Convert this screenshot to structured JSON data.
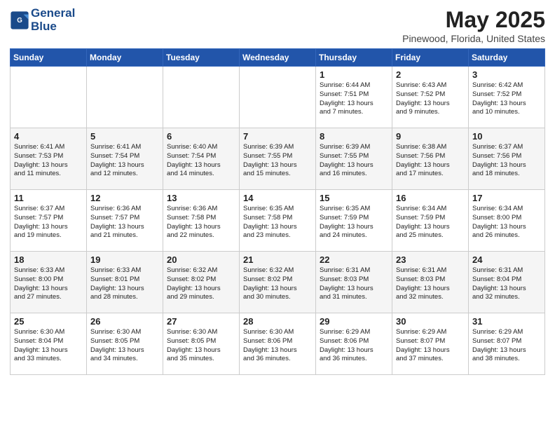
{
  "header": {
    "logo_line1": "General",
    "logo_line2": "Blue",
    "month": "May 2025",
    "location": "Pinewood, Florida, United States"
  },
  "weekdays": [
    "Sunday",
    "Monday",
    "Tuesday",
    "Wednesday",
    "Thursday",
    "Friday",
    "Saturday"
  ],
  "weeks": [
    [
      {
        "day": "",
        "info": ""
      },
      {
        "day": "",
        "info": ""
      },
      {
        "day": "",
        "info": ""
      },
      {
        "day": "",
        "info": ""
      },
      {
        "day": "1",
        "info": "Sunrise: 6:44 AM\nSunset: 7:51 PM\nDaylight: 13 hours\nand 7 minutes."
      },
      {
        "day": "2",
        "info": "Sunrise: 6:43 AM\nSunset: 7:52 PM\nDaylight: 13 hours\nand 9 minutes."
      },
      {
        "day": "3",
        "info": "Sunrise: 6:42 AM\nSunset: 7:52 PM\nDaylight: 13 hours\nand 10 minutes."
      }
    ],
    [
      {
        "day": "4",
        "info": "Sunrise: 6:41 AM\nSunset: 7:53 PM\nDaylight: 13 hours\nand 11 minutes."
      },
      {
        "day": "5",
        "info": "Sunrise: 6:41 AM\nSunset: 7:54 PM\nDaylight: 13 hours\nand 12 minutes."
      },
      {
        "day": "6",
        "info": "Sunrise: 6:40 AM\nSunset: 7:54 PM\nDaylight: 13 hours\nand 14 minutes."
      },
      {
        "day": "7",
        "info": "Sunrise: 6:39 AM\nSunset: 7:55 PM\nDaylight: 13 hours\nand 15 minutes."
      },
      {
        "day": "8",
        "info": "Sunrise: 6:39 AM\nSunset: 7:55 PM\nDaylight: 13 hours\nand 16 minutes."
      },
      {
        "day": "9",
        "info": "Sunrise: 6:38 AM\nSunset: 7:56 PM\nDaylight: 13 hours\nand 17 minutes."
      },
      {
        "day": "10",
        "info": "Sunrise: 6:37 AM\nSunset: 7:56 PM\nDaylight: 13 hours\nand 18 minutes."
      }
    ],
    [
      {
        "day": "11",
        "info": "Sunrise: 6:37 AM\nSunset: 7:57 PM\nDaylight: 13 hours\nand 19 minutes."
      },
      {
        "day": "12",
        "info": "Sunrise: 6:36 AM\nSunset: 7:57 PM\nDaylight: 13 hours\nand 21 minutes."
      },
      {
        "day": "13",
        "info": "Sunrise: 6:36 AM\nSunset: 7:58 PM\nDaylight: 13 hours\nand 22 minutes."
      },
      {
        "day": "14",
        "info": "Sunrise: 6:35 AM\nSunset: 7:58 PM\nDaylight: 13 hours\nand 23 minutes."
      },
      {
        "day": "15",
        "info": "Sunrise: 6:35 AM\nSunset: 7:59 PM\nDaylight: 13 hours\nand 24 minutes."
      },
      {
        "day": "16",
        "info": "Sunrise: 6:34 AM\nSunset: 7:59 PM\nDaylight: 13 hours\nand 25 minutes."
      },
      {
        "day": "17",
        "info": "Sunrise: 6:34 AM\nSunset: 8:00 PM\nDaylight: 13 hours\nand 26 minutes."
      }
    ],
    [
      {
        "day": "18",
        "info": "Sunrise: 6:33 AM\nSunset: 8:00 PM\nDaylight: 13 hours\nand 27 minutes."
      },
      {
        "day": "19",
        "info": "Sunrise: 6:33 AM\nSunset: 8:01 PM\nDaylight: 13 hours\nand 28 minutes."
      },
      {
        "day": "20",
        "info": "Sunrise: 6:32 AM\nSunset: 8:02 PM\nDaylight: 13 hours\nand 29 minutes."
      },
      {
        "day": "21",
        "info": "Sunrise: 6:32 AM\nSunset: 8:02 PM\nDaylight: 13 hours\nand 30 minutes."
      },
      {
        "day": "22",
        "info": "Sunrise: 6:31 AM\nSunset: 8:03 PM\nDaylight: 13 hours\nand 31 minutes."
      },
      {
        "day": "23",
        "info": "Sunrise: 6:31 AM\nSunset: 8:03 PM\nDaylight: 13 hours\nand 32 minutes."
      },
      {
        "day": "24",
        "info": "Sunrise: 6:31 AM\nSunset: 8:04 PM\nDaylight: 13 hours\nand 32 minutes."
      }
    ],
    [
      {
        "day": "25",
        "info": "Sunrise: 6:30 AM\nSunset: 8:04 PM\nDaylight: 13 hours\nand 33 minutes."
      },
      {
        "day": "26",
        "info": "Sunrise: 6:30 AM\nSunset: 8:05 PM\nDaylight: 13 hours\nand 34 minutes."
      },
      {
        "day": "27",
        "info": "Sunrise: 6:30 AM\nSunset: 8:05 PM\nDaylight: 13 hours\nand 35 minutes."
      },
      {
        "day": "28",
        "info": "Sunrise: 6:30 AM\nSunset: 8:06 PM\nDaylight: 13 hours\nand 36 minutes."
      },
      {
        "day": "29",
        "info": "Sunrise: 6:29 AM\nSunset: 8:06 PM\nDaylight: 13 hours\nand 36 minutes."
      },
      {
        "day": "30",
        "info": "Sunrise: 6:29 AM\nSunset: 8:07 PM\nDaylight: 13 hours\nand 37 minutes."
      },
      {
        "day": "31",
        "info": "Sunrise: 6:29 AM\nSunset: 8:07 PM\nDaylight: 13 hours\nand 38 minutes."
      }
    ]
  ]
}
